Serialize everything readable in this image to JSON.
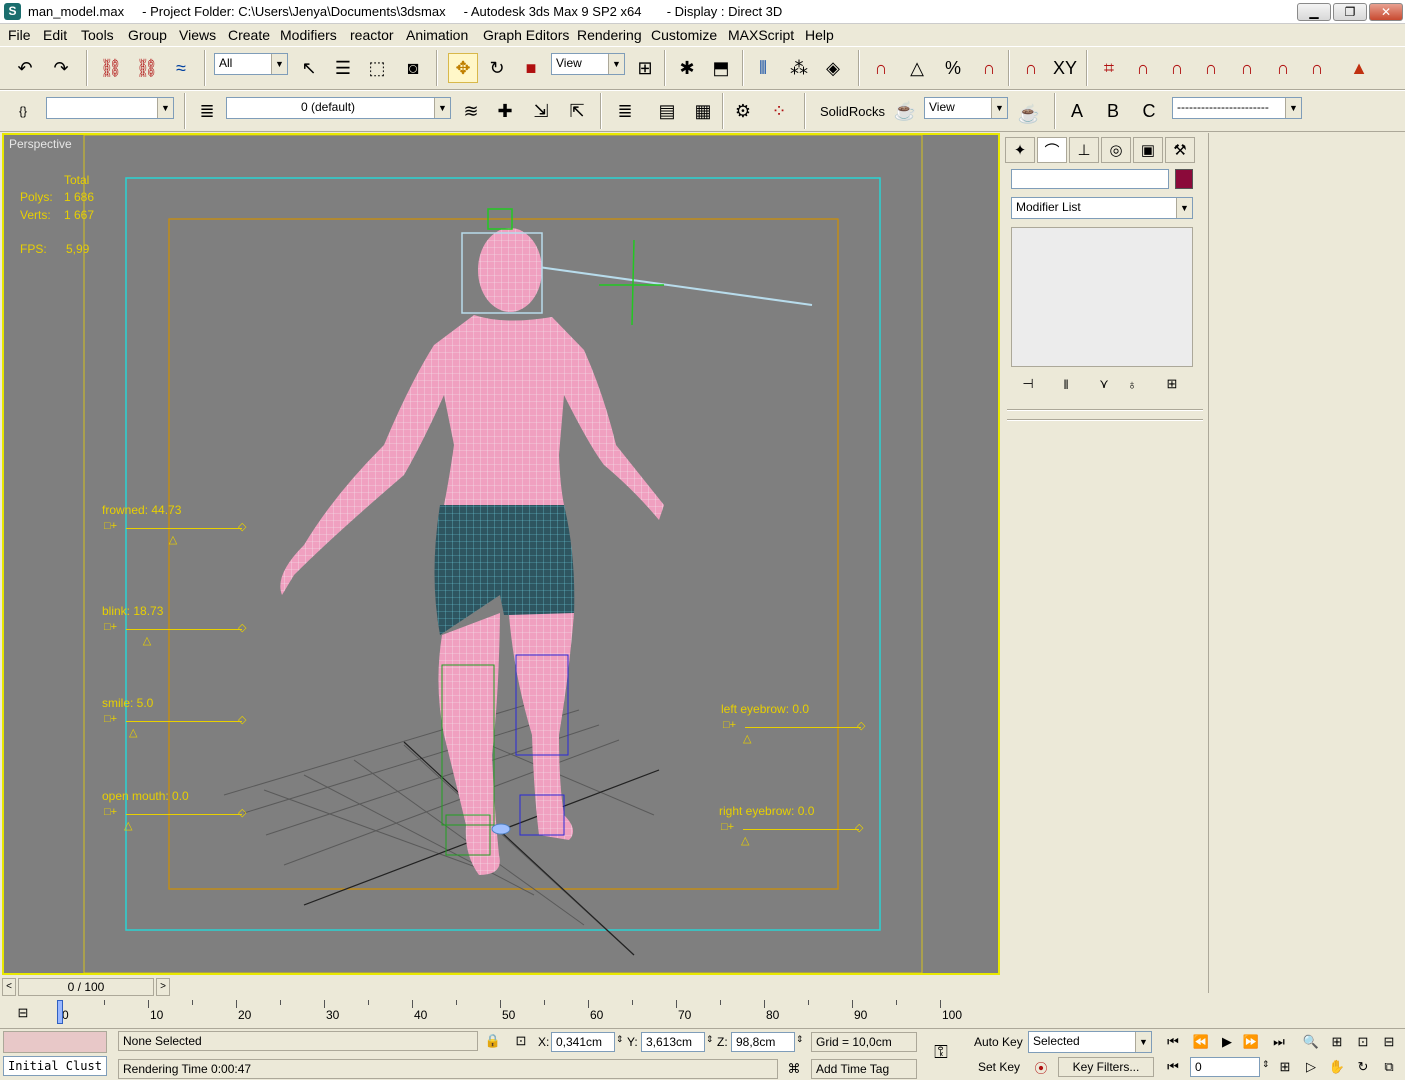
{
  "window": {
    "title": "man_model.max     - Project Folder: C:\\Users\\Jenya\\Documents\\3dsmax     - Autodesk 3ds Max 9 SP2 x64       - Display : Direct 3D",
    "minimize": "▁",
    "maximize": "❐",
    "close": "✕"
  },
  "menu": [
    "File",
    "Edit",
    "Tools",
    "Group",
    "Views",
    "Create",
    "Modifiers",
    "reactor",
    "Animation",
    "Graph Editors",
    "Rendering",
    "Customize",
    "MAXScript",
    "Help"
  ],
  "toolbar1": {
    "selection_filter": "All",
    "ref_coord": "View"
  },
  "toolbar2": {
    "named_selection": "",
    "layer": "0 (default)",
    "solidrocks_label": "SolidRocks",
    "render_view": "View",
    "render_preset": "-----------------------"
  },
  "viewport": {
    "label": "Perspective",
    "stats": {
      "total_label": "Total",
      "polys_label": "Polys:",
      "polys_value": "1 686",
      "verts_label": "Verts:",
      "verts_value": "1 667",
      "fps_label": "FPS:",
      "fps_value": "5,99"
    },
    "morphs": [
      {
        "label": "frowned: 44.73",
        "value": 44.73
      },
      {
        "label": "blink: 18.73",
        "value": 18.73
      },
      {
        "label": "smile: 5.0",
        "value": 5.0
      },
      {
        "label": "open mouth: 0.0",
        "value": 0.0
      },
      {
        "label": "left eyebrow: 0.0",
        "value": 0.0
      },
      {
        "label": "right eyebrow: 0.0",
        "value": 0.0
      }
    ]
  },
  "command_panel": {
    "object_name": "",
    "object_color": "#8b0a3a",
    "modifier_list": "Modifier List"
  },
  "timeline": {
    "frame_display": "0 / 100",
    "ticks": [
      "0",
      "10",
      "20",
      "30",
      "40",
      "50",
      "60",
      "70",
      "80",
      "90",
      "100"
    ]
  },
  "status": {
    "maxscript_listener": "Initial Clust",
    "selection_status": "None Selected",
    "prompt": "Rendering Time  0:00:47",
    "x_label": "X:",
    "x_value": "0,341cm",
    "y_label": "Y:",
    "y_value": "3,613cm",
    "z_label": "Z:",
    "z_value": "98,8cm",
    "grid": "Grid = 10,0cm",
    "add_time_tag": "Add Time Tag",
    "auto_key": "Auto Key",
    "set_key": "Set Key",
    "key_mode": "Selected",
    "key_filters": "Key Filters...",
    "current_frame": "0"
  }
}
